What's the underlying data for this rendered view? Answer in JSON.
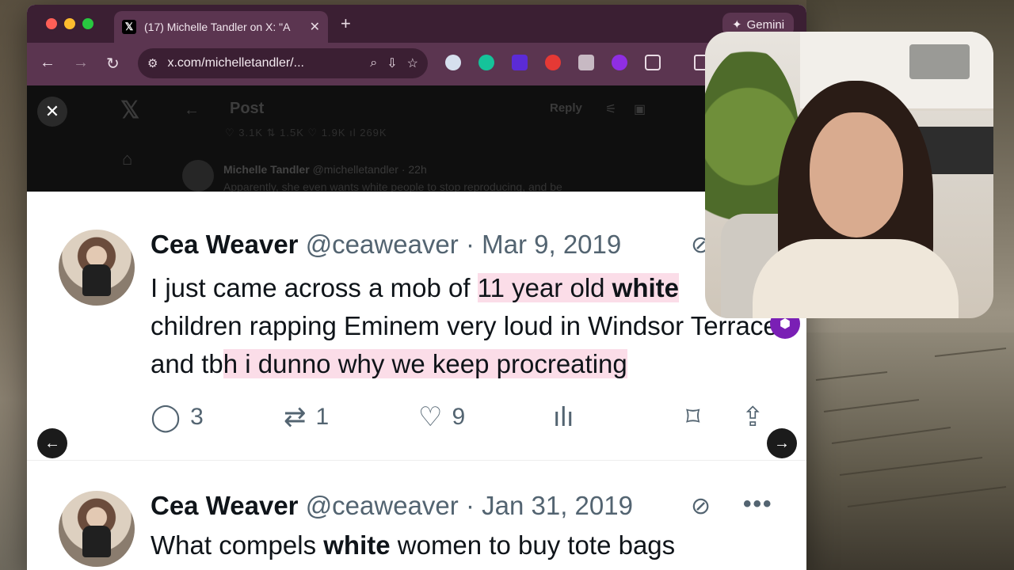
{
  "browser": {
    "tab_title": "(17) Michelle Tandler on X: \"A",
    "favicon_glyph": "𝕏",
    "tab_close": "✕",
    "new_tab": "+",
    "gemini_label": "Gemini",
    "url": "x.com/michelletandler/...",
    "accent_color": "#5b3550"
  },
  "background_page": {
    "post_title": "Post",
    "reply_label": "Reply",
    "stats": "♡ 3.1K     ⇅ 1.5K     ♡ 1.9K     ıl 269K",
    "sub_author": "Michelle Tandler",
    "sub_handle_time": "@michelletandler · 22h",
    "sub_text": "Apparently, she even wants white people to stop reproducing, and be"
  },
  "tweets": [
    {
      "name": "Cea Weaver",
      "handle": "@ceaweaver",
      "separator": "·",
      "date": "Mar 9, 2019",
      "body": {
        "part1": "I just came across a mob of ",
        "hl1": "11 year old ",
        "bold1": "white",
        "part2": "children rapping Eminem very loud in Windsor Terrace and tb",
        "hl2": "h i dunno why we keep procreating"
      },
      "reply_count": "3",
      "retweet_count": "1",
      "like_count": "9"
    },
    {
      "name": "Cea Weaver",
      "handle": "@ceaweaver",
      "separator": "·",
      "date": "Jan 31, 2019",
      "body": {
        "part1": "What compels ",
        "bold1": "white",
        "part2": " women to buy tote bags"
      }
    }
  ],
  "icons": {
    "close": "✕",
    "prev": "←",
    "next": "→",
    "reply": "◯",
    "retweet": "⇄",
    "like": "♡",
    "views": "ılı",
    "bookmark": "⌑",
    "share": "⇪",
    "grok": "⊘",
    "more": "•••"
  }
}
